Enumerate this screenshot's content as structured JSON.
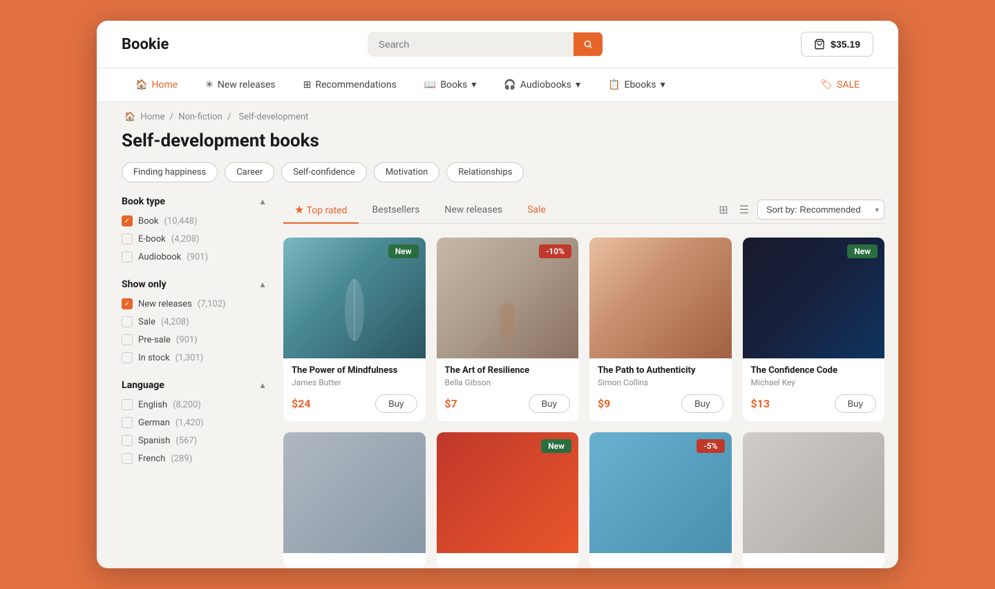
{
  "app": {
    "logo": "Bookie",
    "search": {
      "placeholder": "Search"
    },
    "cart": {
      "amount": "$35.19"
    }
  },
  "nav": {
    "items": [
      {
        "id": "home",
        "label": "Home",
        "icon": "🏠",
        "active": true
      },
      {
        "id": "new-releases",
        "label": "New releases",
        "icon": "✳"
      },
      {
        "id": "recommendations",
        "label": "Recommendations",
        "icon": "⊞"
      },
      {
        "id": "books",
        "label": "Books",
        "icon": "📖",
        "has_arrow": true
      },
      {
        "id": "audiobooks",
        "label": "Audiobooks",
        "icon": "🎧",
        "has_arrow": true
      },
      {
        "id": "ebooks",
        "label": "Ebooks",
        "icon": "📋",
        "has_arrow": true
      },
      {
        "id": "sale",
        "label": "SALE",
        "icon": "🏷",
        "is_sale": true
      }
    ]
  },
  "breadcrumb": {
    "items": [
      "Home",
      "Non-fiction",
      "Self-development"
    ]
  },
  "page": {
    "title": "Self-development books"
  },
  "chips": [
    "Finding happiness",
    "Career",
    "Self-confidence",
    "Motivation",
    "Relationships"
  ],
  "sidebar": {
    "sections": [
      {
        "id": "book-type",
        "title": "Book type",
        "items": [
          {
            "label": "Book",
            "count": "(10,448)",
            "checked": true
          },
          {
            "label": "E-book",
            "count": "(4,208)",
            "checked": false
          },
          {
            "label": "Audiobook",
            "count": "(901)",
            "checked": false
          }
        ]
      },
      {
        "id": "show-only",
        "title": "Show only",
        "items": [
          {
            "label": "New releases",
            "count": "(7,102)",
            "checked": true
          },
          {
            "label": "Sale",
            "count": "(4,208)",
            "checked": false
          },
          {
            "label": "Pre-sale",
            "count": "(901)",
            "checked": false
          },
          {
            "label": "In stock",
            "count": "(1,301)",
            "checked": false
          }
        ]
      },
      {
        "id": "language",
        "title": "Language",
        "items": [
          {
            "label": "English",
            "count": "(8,200)",
            "checked": false
          },
          {
            "label": "German",
            "count": "(1,420)",
            "checked": false
          },
          {
            "label": "Spanish",
            "count": "(567)",
            "checked": false
          },
          {
            "label": "French",
            "count": "(289)",
            "checked": false
          }
        ]
      }
    ]
  },
  "tabs": [
    {
      "id": "top-rated",
      "label": "Top rated",
      "icon": "★",
      "active": true
    },
    {
      "id": "bestsellers",
      "label": "Bestsellers",
      "active": false
    },
    {
      "id": "new-releases",
      "label": "New releases",
      "active": false
    },
    {
      "id": "sale",
      "label": "Sale",
      "is_sale": true,
      "active": false
    }
  ],
  "sort": {
    "label": "Sort by: Recommended"
  },
  "products": [
    {
      "id": "1",
      "title": "The Power of Mindfulness",
      "author": "James Butter",
      "price": "$24",
      "badge": "New",
      "badge_type": "new",
      "img_class": "img-mindfulness"
    },
    {
      "id": "2",
      "title": "The Art of Resilience",
      "author": "Bella Gibson",
      "price": "$7",
      "badge": "-10%",
      "badge_type": "discount",
      "img_class": "img-resilience"
    },
    {
      "id": "3",
      "title": "The Path to Authenticity",
      "author": "Simon Collins",
      "price": "$9",
      "badge": null,
      "badge_type": null,
      "img_class": "img-authenticity"
    },
    {
      "id": "4",
      "title": "The Confidence Code",
      "author": "Michael Key",
      "price": "$13",
      "badge": "New",
      "badge_type": "new",
      "img_class": "img-confidence"
    },
    {
      "id": "5",
      "title": "",
      "author": "",
      "price": "",
      "badge": null,
      "badge_type": null,
      "img_class": "img-bottom1"
    },
    {
      "id": "6",
      "title": "",
      "author": "",
      "price": "",
      "badge": "New",
      "badge_type": "new",
      "img_class": "img-bottom2"
    },
    {
      "id": "7",
      "title": "",
      "author": "",
      "price": "",
      "badge": "-5%",
      "badge_type": "discount",
      "img_class": "img-bottom3"
    },
    {
      "id": "8",
      "title": "",
      "author": "",
      "price": "",
      "badge": null,
      "badge_type": null,
      "img_class": "img-bottom4"
    }
  ],
  "labels": {
    "buy": "Buy",
    "grid_view": "⊞",
    "list_view": "☰"
  }
}
